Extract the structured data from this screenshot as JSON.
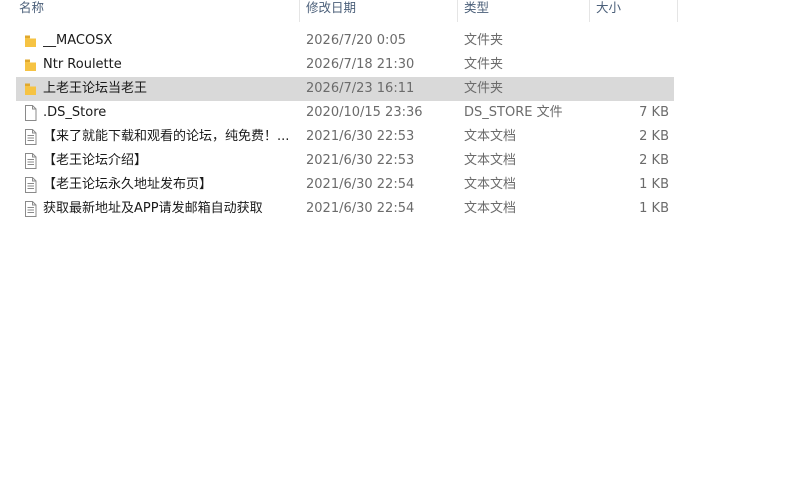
{
  "columns": {
    "name": "名称",
    "date": "修改日期",
    "type": "类型",
    "size": "大小"
  },
  "files": [
    {
      "name": "__MACOSX",
      "date": "2026/7/20 0:05",
      "type": "文件夹",
      "size": "",
      "icon": "folder-icon",
      "selected": false
    },
    {
      "name": "Ntr Roulette",
      "date": "2026/7/18 21:30",
      "type": "文件夹",
      "size": "",
      "icon": "folder-icon",
      "selected": false
    },
    {
      "name": "上老王论坛当老王",
      "date": "2026/7/23 16:11",
      "type": "文件夹",
      "size": "",
      "icon": "folder-icon",
      "selected": true
    },
    {
      "name": ".DS_Store",
      "date": "2020/10/15 23:36",
      "type": "DS_STORE 文件",
      "size": "7 KB",
      "icon": "blank-file-icon",
      "selected": false
    },
    {
      "name": "【来了就能下载和观看的论坛，纯免费！...",
      "date": "2021/6/30 22:53",
      "type": "文本文档",
      "size": "2 KB",
      "icon": "text-file-icon",
      "selected": false
    },
    {
      "name": "【老王论坛介绍】",
      "date": "2021/6/30 22:53",
      "type": "文本文档",
      "size": "2 KB",
      "icon": "text-file-icon",
      "selected": false
    },
    {
      "name": "【老王论坛永久地址发布页】",
      "date": "2021/6/30 22:54",
      "type": "文本文档",
      "size": "1 KB",
      "icon": "text-file-icon",
      "selected": false
    },
    {
      "name": "获取最新地址及APP请发邮箱自动获取",
      "date": "2021/6/30 22:54",
      "type": "文本文档",
      "size": "1 KB",
      "icon": "text-file-icon",
      "selected": false
    }
  ],
  "colors": {
    "folder": "#f6c343",
    "folder_dark": "#e0a82e",
    "selected_row": "#d9d9d9",
    "header_text": "#4c607a"
  }
}
